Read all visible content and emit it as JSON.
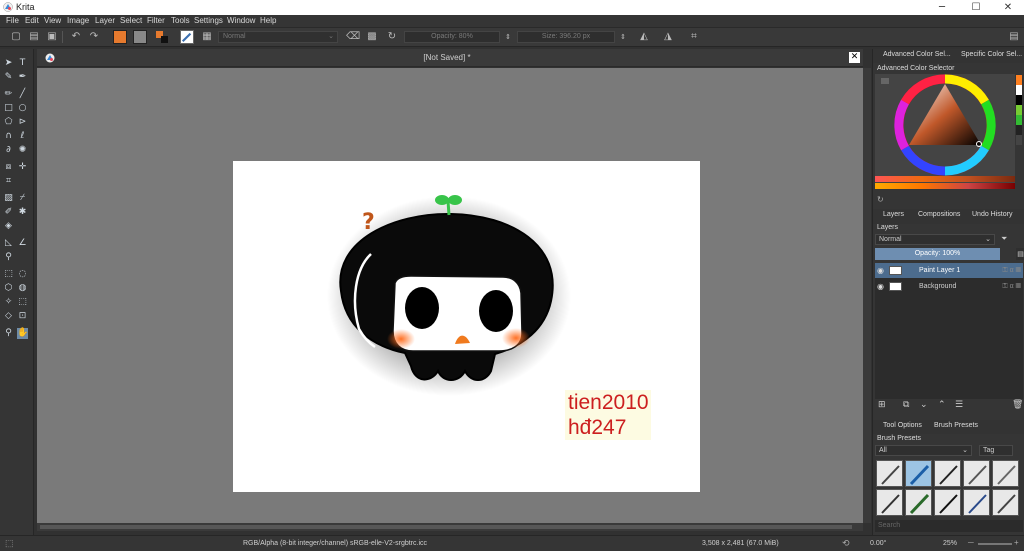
{
  "window": {
    "title": "Krita",
    "minimize": "─",
    "maximize": "☐",
    "close": "✕"
  },
  "menu": [
    "File",
    "Edit",
    "View",
    "Image",
    "Layer",
    "Select",
    "Filter",
    "Tools",
    "Settings",
    "Window",
    "Help"
  ],
  "toolbar": {
    "blend_mode": "Normal",
    "opacity": "Opacity: 80%",
    "size": "Size: 396.20 px",
    "fg_color": "#e67a2e",
    "bg_color": "#888888"
  },
  "document": {
    "title": "[Not Saved]  *",
    "close": "✕"
  },
  "canvas_text": {
    "line1": "tien2010",
    "line2": "hđ247",
    "question": "?"
  },
  "right_dock": {
    "top_tabs": [
      "Advanced Color Sel...",
      "Specific Color Sel..."
    ],
    "color_selector_title": "Advanced Color Selector",
    "layer_tabs": [
      "Layers",
      "Compositions",
      "Undo History"
    ],
    "layers_title": "Layers",
    "blend_mode": "Normal",
    "opacity": "Opacity:  100%",
    "layers": [
      {
        "name": "Paint Layer 1",
        "selected": true
      },
      {
        "name": "Background",
        "selected": false
      }
    ],
    "bottom_tabs": [
      "Tool Options",
      "Brush Presets"
    ],
    "brush_presets_title": "Brush Presets",
    "brush_filter": "All",
    "tag_label": "Tag",
    "search_placeholder": "Search"
  },
  "status": {
    "color_info": "RGB/Alpha (8-bit integer/channel)  sRGB-elle-V2-srgbtrc.icc",
    "dimensions": "3,508 x 2,481 (67.0 MiB)",
    "rotation": "0.00°",
    "zoom": "25%"
  }
}
